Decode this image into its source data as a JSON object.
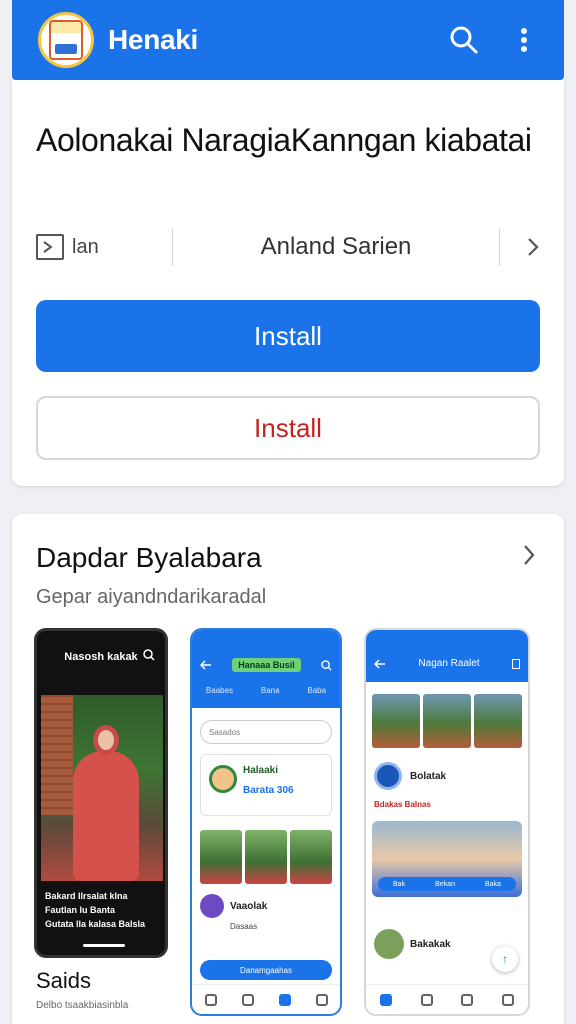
{
  "app": {
    "title": "Henaki"
  },
  "colors": {
    "primary": "#1a73e8",
    "install_outline_text": "#c5221f"
  },
  "icons": {
    "logo": "app-logo-icon",
    "search": "search-icon",
    "menu": "more-vert-icon",
    "chevron": "chevron-right-icon"
  },
  "detail": {
    "headline": "Aolonakai NaragiaKanngan kiabatai",
    "info_left": "lan",
    "info_mid": "Anland Sarien",
    "install_primary": "Install",
    "install_secondary": "Install"
  },
  "gallery": {
    "title": "Dapdar Byalabara",
    "subtitle": "Gepar aiyandndarikaradal",
    "shot1": {
      "bar_title": "Nasosh kakak",
      "caption_1": "Bakard Ilrsalat klna",
      "caption_2": "Fautlan lu Banta",
      "caption_3": "Gutata lla kalasa Balsla"
    },
    "shot2": {
      "pill": "Hanaaa Busil",
      "tab1": "Baabes",
      "tab2": "Bana",
      "tab3": "Baba",
      "search": "Sasados",
      "card_t1": "Halaaki",
      "card_t2": "Barata 306",
      "user": "Vaaolak",
      "user_sub": "Dasaas",
      "button": "Danamgaahas"
    },
    "shot3": {
      "bar_title": "Nagan Raalet",
      "user": "Bolatak",
      "tags": "Bdakas Balnas",
      "strip_1": "Bak",
      "strip_2": "Bekan",
      "strip_3": "Baka",
      "post": "Bakakak"
    },
    "footer_title": "Saids",
    "footer_sub": "Delbo tsaakbiasinbla"
  }
}
